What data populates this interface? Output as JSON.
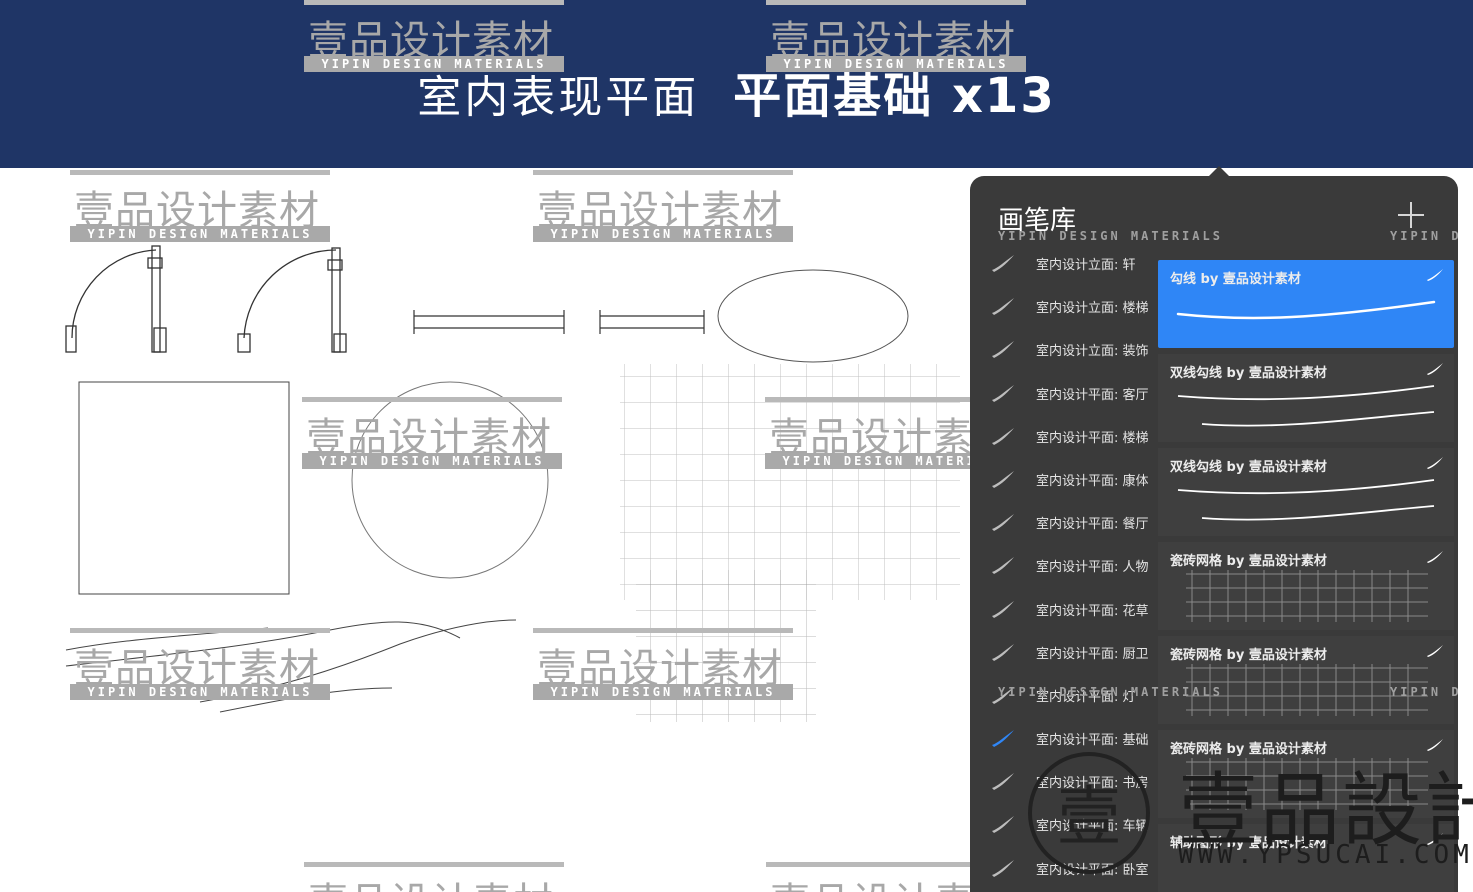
{
  "header": {
    "title_light": "室内表现平面",
    "title_bold": "平面基础 x13",
    "background": "#1f3566"
  },
  "watermark": {
    "cn": "壹品设计素材",
    "en": "YIPIN DESIGN MATERIALS",
    "en_short": "YIPIN D"
  },
  "brush_library": {
    "title": "画笔库",
    "add_icon": "plus-icon",
    "brush_sets": [
      {
        "label": "室内设计立面: 轩",
        "active": false
      },
      {
        "label": "室内设计立面: 楼梯",
        "active": false
      },
      {
        "label": "室内设计立面: 装饰",
        "active": false
      },
      {
        "label": "室内设计平面: 客厅",
        "active": false
      },
      {
        "label": "室内设计平面: 楼梯",
        "active": false
      },
      {
        "label": "室内设计平面: 康体",
        "active": false
      },
      {
        "label": "室内设计平面: 餐厅",
        "active": false
      },
      {
        "label": "室内设计平面: 人物",
        "active": false
      },
      {
        "label": "室内设计平面: 花草",
        "active": false
      },
      {
        "label": "室内设计平面: 厨卫",
        "active": false
      },
      {
        "label": "室内设计平面: 灯",
        "active": false
      },
      {
        "label": "室内设计平面: 基础",
        "active": true
      },
      {
        "label": "室内设计平面: 书房",
        "active": false
      },
      {
        "label": "室内设计平面: 车辆",
        "active": false
      },
      {
        "label": "室内设计平面: 卧室",
        "active": false
      }
    ],
    "brushes": [
      {
        "name": "勾线 by 壹品设计素材",
        "selected": true,
        "preview": "single-line"
      },
      {
        "name": "双线勾线 by 壹品设计素材",
        "selected": false,
        "preview": "double-line"
      },
      {
        "name": "双线勾线 by 壹品设计素材",
        "selected": false,
        "preview": "double-line"
      },
      {
        "name": "瓷砖网格 by 壹品设计素材",
        "selected": false,
        "preview": "grid"
      },
      {
        "name": "瓷砖网格 by 壹品设计素材",
        "selected": false,
        "preview": "grid"
      },
      {
        "name": "瓷砖网格 by 壹品设计素材",
        "selected": false,
        "preview": "grid"
      },
      {
        "name": "辅助图形 by 壹品设计素材",
        "selected": false,
        "preview": "shapes"
      }
    ],
    "accent": "#2f86f6",
    "panel_bg": "#3a3a3a"
  },
  "logo": {
    "glyph": "壹",
    "cn": "壹品設計",
    "url": "WWW.YPSUCAI.COM"
  }
}
